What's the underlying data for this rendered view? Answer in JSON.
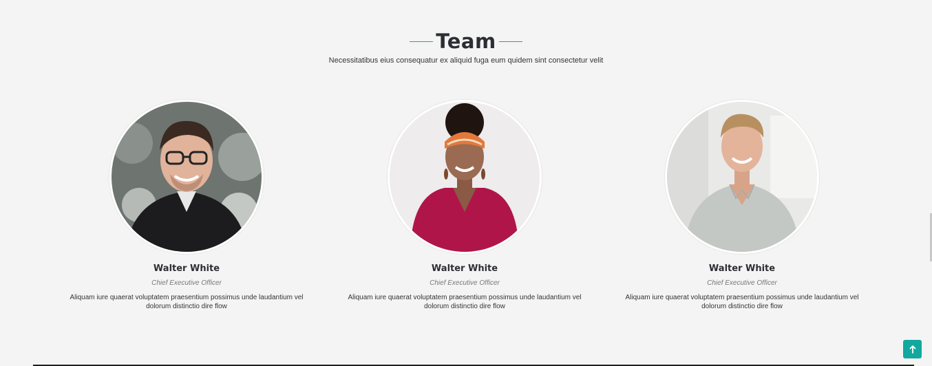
{
  "section": {
    "title": "Team",
    "subtitle": "Necessitatibus eius consequatur ex aliquid fuga eum quidem sint consectetur velit"
  },
  "members": [
    {
      "name": "Walter White",
      "role": "Chief Executive Officer",
      "description": "Aliquam iure quaerat voluptatem praesentium possimus unde laudantium vel dolorum distinctio dire flow"
    },
    {
      "name": "Walter White",
      "role": "Chief Executive Officer",
      "description": "Aliquam iure quaerat voluptatem praesentium possimus unde laudantium vel dolorum distinctio dire flow"
    },
    {
      "name": "Walter White",
      "role": "Chief Executive Officer",
      "description": "Aliquam iure quaerat voluptatem praesentium possimus unde laudantium vel dolorum distinctio dire flow"
    }
  ],
  "colors": {
    "accent": "#13a89e",
    "background": "#f4f4f4",
    "heading": "#2d2e33"
  },
  "icons": {
    "scroll_top": "arrow-up-icon"
  }
}
